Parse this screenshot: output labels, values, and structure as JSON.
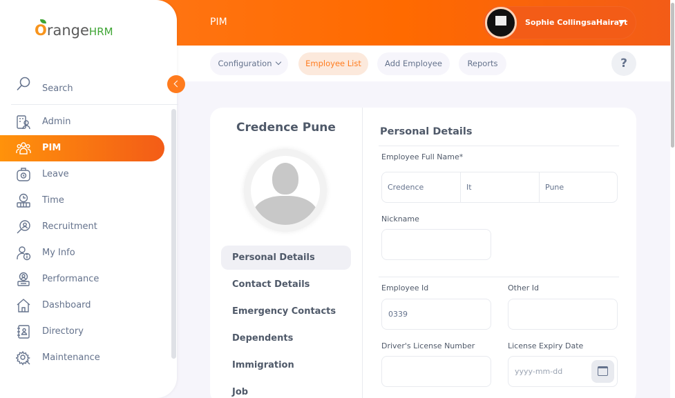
{
  "header": {
    "module_title": "PIM",
    "user_name": "Sophie CollingsaHairayt"
  },
  "subnav": {
    "tabs": [
      {
        "label": "Configuration"
      },
      {
        "label": "Employee List"
      },
      {
        "label": "Add Employee"
      },
      {
        "label": "Reports"
      }
    ],
    "help_label": "?"
  },
  "sidebar": {
    "logo": {
      "o": "O",
      "range": "range",
      "hrm": "HRM"
    },
    "search_label": "Search",
    "items": [
      {
        "label": "Admin",
        "icon": "admin-icon"
      },
      {
        "label": "PIM",
        "icon": "pim-icon"
      },
      {
        "label": "Leave",
        "icon": "leave-icon"
      },
      {
        "label": "Time",
        "icon": "time-icon"
      },
      {
        "label": "Recruitment",
        "icon": "recruitment-icon"
      },
      {
        "label": "My Info",
        "icon": "my-info-icon"
      },
      {
        "label": "Performance",
        "icon": "performance-icon"
      },
      {
        "label": "Dashboard",
        "icon": "dashboard-icon"
      },
      {
        "label": "Directory",
        "icon": "directory-icon"
      },
      {
        "label": "Maintenance",
        "icon": "maintenance-icon"
      }
    ]
  },
  "employee": {
    "name": "Credence Pune",
    "menu": [
      {
        "label": "Personal Details"
      },
      {
        "label": "Contact Details"
      },
      {
        "label": "Emergency Contacts"
      },
      {
        "label": "Dependents"
      },
      {
        "label": "Immigration"
      },
      {
        "label": "Job"
      }
    ]
  },
  "form": {
    "section_title": "Personal Details",
    "full_name_label": "Employee Full Name*",
    "first_name": "Credence",
    "middle_name": "It",
    "last_name": "Pune",
    "nickname_label": "Nickname",
    "nickname": "",
    "employee_id_label": "Employee Id",
    "employee_id": "0339",
    "other_id_label": "Other Id",
    "other_id": "",
    "license_label": "Driver's License Number",
    "license": "",
    "expiry_label": "License Expiry Date",
    "expiry_placeholder": "yyyy-mm-dd"
  },
  "colors": {
    "brand_orange": "#ff7b1d",
    "active_tab_bg": "#fce9dc",
    "text": "#64728c"
  }
}
